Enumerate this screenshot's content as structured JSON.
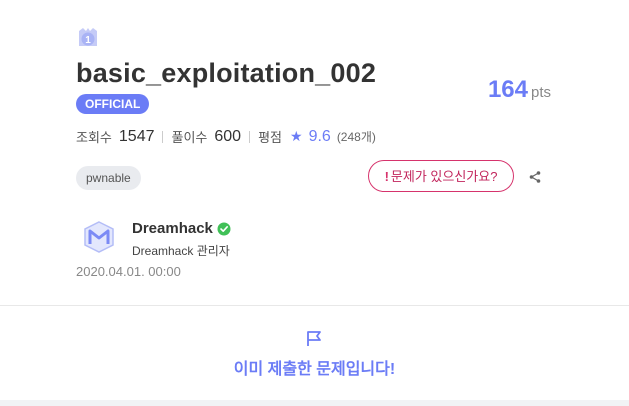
{
  "challenge": {
    "level": "1",
    "title": "basic_exploitation_002",
    "badge": "OFFICIAL",
    "points": "164",
    "points_unit": "pts"
  },
  "stats": {
    "views_label": "조회수",
    "views": "1547",
    "solves_label": "풀이수",
    "solves": "600",
    "rating_label": "평점",
    "rating": "9.6",
    "rating_count": "(248개)"
  },
  "tags": [
    "pwnable"
  ],
  "report_label": "문제가 있으신가요?",
  "author": {
    "name": "Dreamhack",
    "role": "Dreamhack 관리자",
    "date": "2020.04.01. 00:00"
  },
  "status": {
    "message": "이미 제출한 문제입니다!"
  },
  "colors": {
    "accent": "#6b7cf6",
    "report": "#d6336c",
    "verified": "#40c057"
  }
}
